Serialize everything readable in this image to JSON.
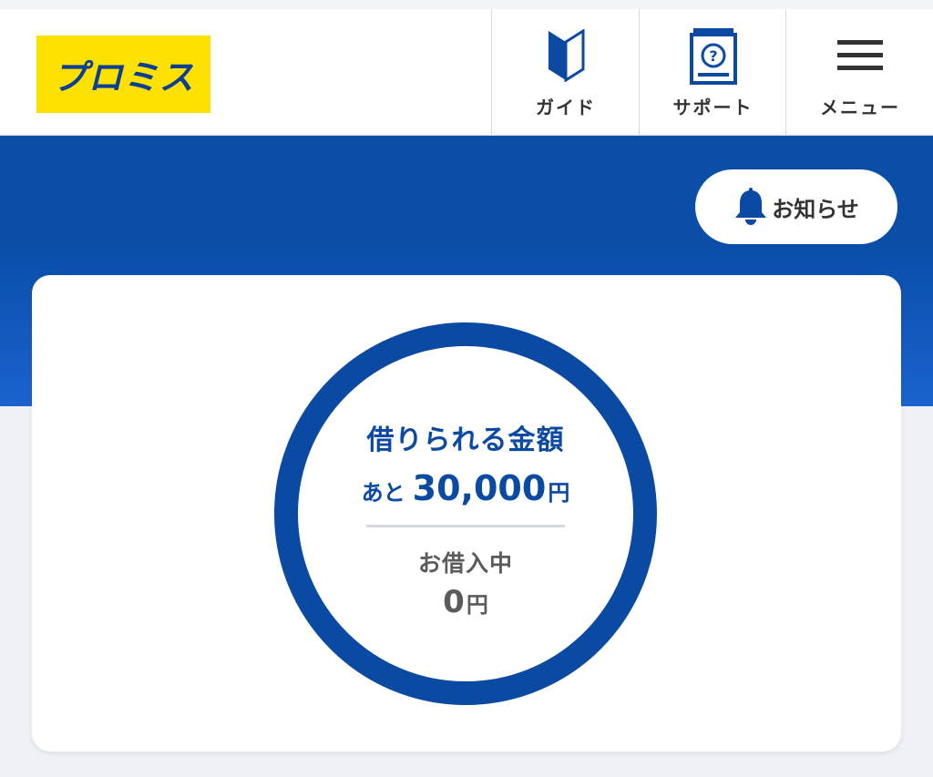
{
  "header": {
    "logo_text": "プロミス",
    "nav": [
      {
        "label": "ガイド",
        "icon": "beginner-mark-icon"
      },
      {
        "label": "サポート",
        "icon": "help-book-icon"
      },
      {
        "label": "メニュー",
        "icon": "hamburger-menu-icon"
      }
    ]
  },
  "notice": {
    "label": "お知らせ",
    "icon": "bell-icon"
  },
  "summary": {
    "available_title": "借りられる金額",
    "available_prefix": "あと",
    "available_amount": "30,000",
    "available_unit": "円",
    "borrowing_label": "お借入中",
    "borrowing_amount": "0",
    "borrowing_unit": "円"
  },
  "colors": {
    "brand_blue": "#0b4aa2",
    "logo_yellow": "#ffe100",
    "hero_blue": "#0a4ea8"
  }
}
